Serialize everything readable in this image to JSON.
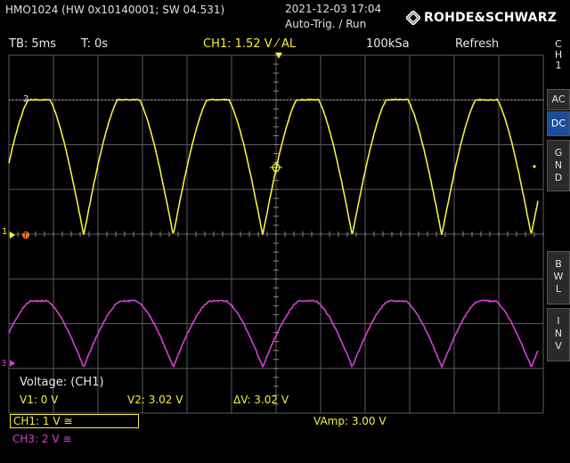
{
  "header": {
    "device": "HMO1024 (HW 0x10140001; SW 04.531)",
    "datetime": "2021-12-03 17:04",
    "trigger_state": "Auto-Trig. / Run",
    "brand": "ROHDE&SCHWARZ"
  },
  "status": {
    "timebase": "TB: 5ms",
    "trigger_time": "T: 0s",
    "ch1_trigger": "CH1: 1.52 V ⁄ AL",
    "sample_rate": "100kSa",
    "acq_mode": "Refresh"
  },
  "side_menu": {
    "channel": [
      "C",
      "H",
      "1"
    ],
    "ac": "AC",
    "dc": "DC",
    "gnd": [
      "G",
      "N",
      "D"
    ],
    "bwl": [
      "B",
      "W",
      "L"
    ],
    "inv": [
      "I",
      "N",
      "V"
    ]
  },
  "markers": {
    "cursor2": "2",
    "ch1_ref": "1",
    "ch3_ref": "3"
  },
  "measurements": {
    "title": "Voltage: (CH1)",
    "v1": "V1: 0 V",
    "v2": "V2: 3.02 V",
    "dv": "ΔV: 3.02 V",
    "vamp": "VAmp: 3.00 V"
  },
  "channels": {
    "ch1": "CH1: 1 V ≅",
    "ch3": "CH3: 2 V ≅"
  },
  "colors": {
    "ch1": "#f4ef3a",
    "ch3": "#d63fd6",
    "grid": "#6a6a6a",
    "accent_blue": "#1c4c9c",
    "trigger_marker": "#ff7a1a"
  }
}
